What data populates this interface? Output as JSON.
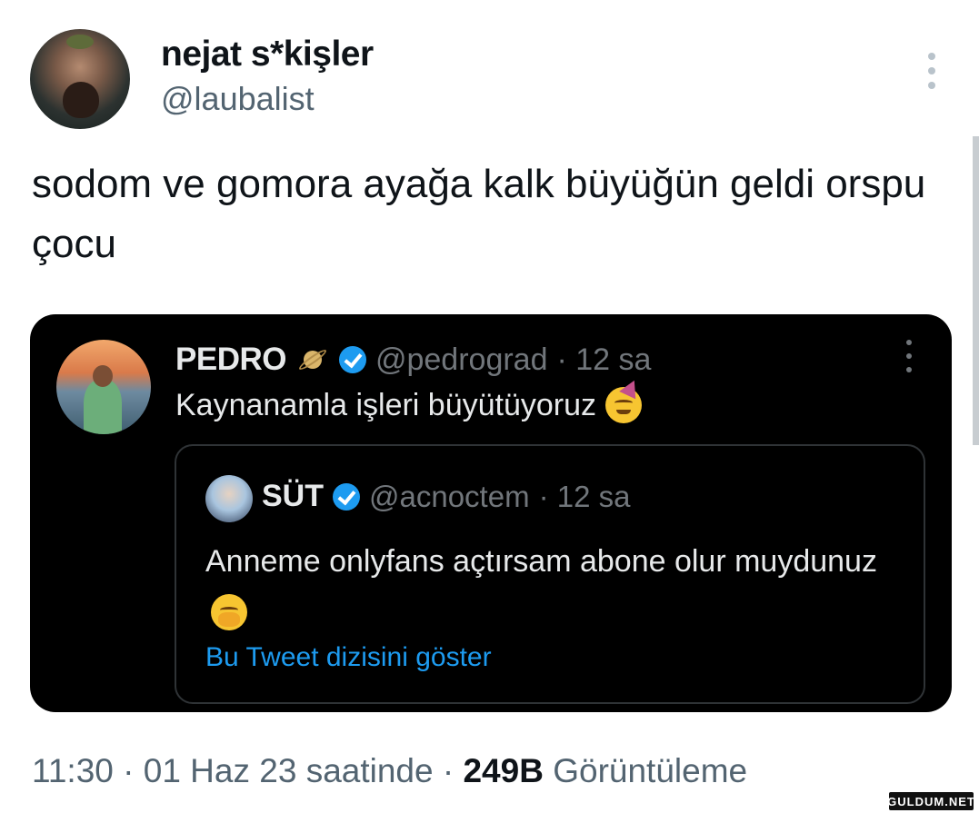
{
  "tweet": {
    "author_name": "nejat s*kişler",
    "author_handle": "@laubalist",
    "text": "sodom ve gomora ayağa kalk büyüğün geldi orspu çocu",
    "time": "11:30",
    "date": "01 Haz 23 saatinde",
    "separator": "·",
    "views_count": "249B",
    "views_label": "Görüntüleme"
  },
  "quote": {
    "name": "PEDRO",
    "handle": "@pedrograd",
    "time": "· 12 sa",
    "text": "Kaynanamla işleri büyütüyoruz",
    "icons": [
      "planet-icon",
      "verified-icon",
      "party-face-icon"
    ],
    "nested": {
      "name": "SÜT",
      "handle": "@acnoctem",
      "time": "· 12 sa",
      "text": "Anneme onlyfans açtırsam abone olur muydunuz",
      "link": "Bu Tweet dizisini göster",
      "icons": [
        "verified-icon",
        "hand-over-mouth-icon"
      ]
    }
  },
  "watermark": "GULDUM.NET",
  "colors": {
    "accent": "#1d9bf0",
    "secondary_text": "#536471",
    "card_background": "#000000"
  }
}
